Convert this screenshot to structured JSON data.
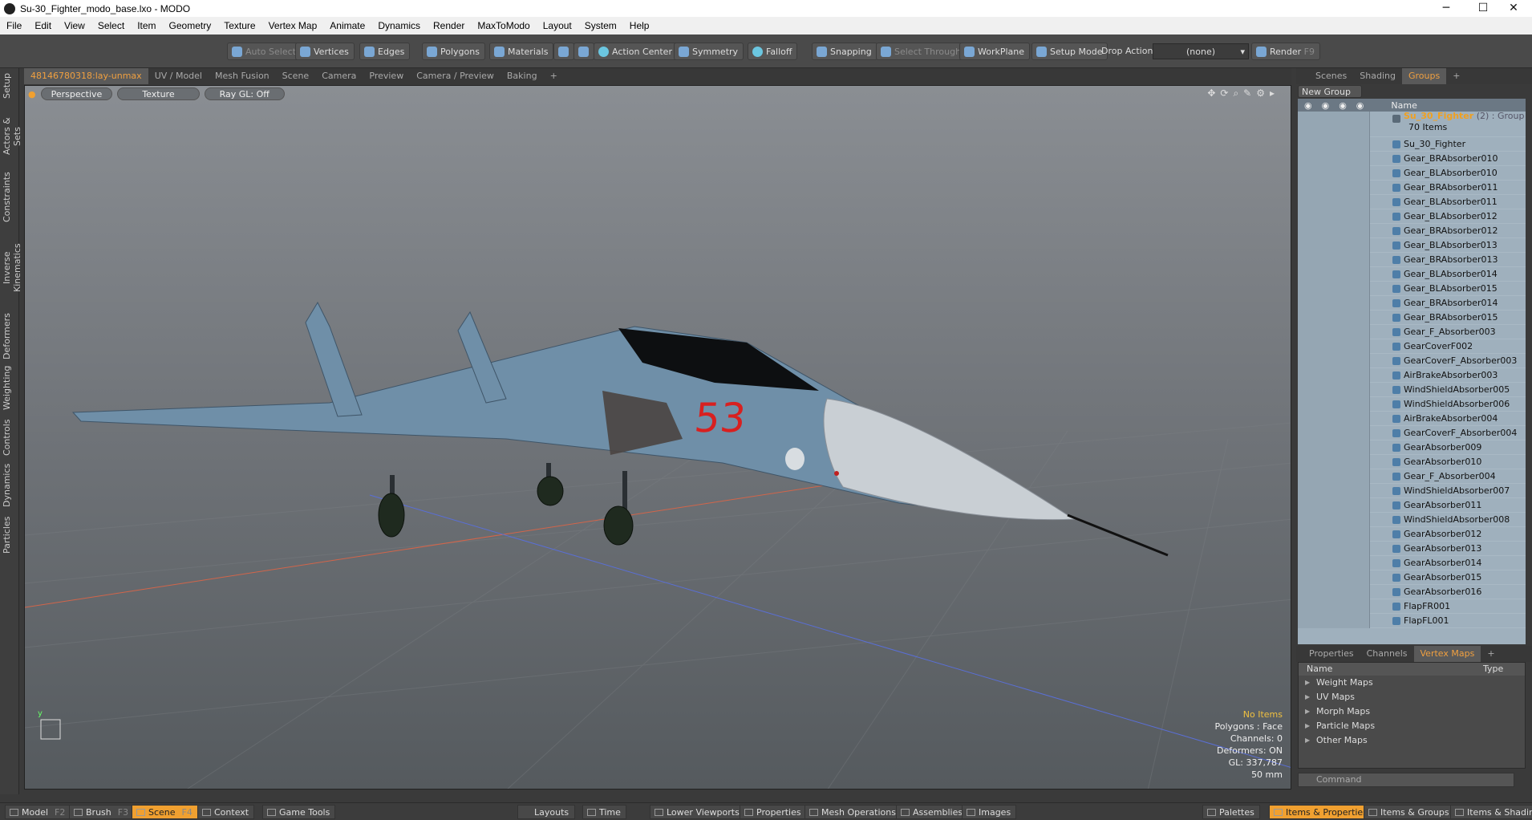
{
  "window": {
    "title": "Su-30_Fighter_modo_base.lxo - MODO",
    "min": "─",
    "max": "☐",
    "close": "✕"
  },
  "menu": [
    "File",
    "Edit",
    "View",
    "Select",
    "Item",
    "Geometry",
    "Texture",
    "Vertex Map",
    "Animate",
    "Dynamics",
    "Render",
    "MaxToModo",
    "Layout",
    "System",
    "Help"
  ],
  "toolbar": {
    "auto_select": "Auto Select",
    "vertices": "Vertices",
    "edges": "Edges",
    "polygons": "Polygons",
    "materials": "Materials",
    "action_center": "Action Center",
    "symmetry": "Symmetry",
    "falloff": "Falloff",
    "snapping": "Snapping",
    "select_through": "Select Through",
    "workplane": "WorkPlane",
    "setup_mode": "Setup Mode",
    "drop_action": "Drop Action",
    "drop_value": "(none)",
    "render": "Render",
    "render_key": "F9"
  },
  "left_tabs": [
    "Setup",
    "Actors & Sets",
    "Constraints",
    "Inverse Kinematics",
    "Deformers",
    "Weighting",
    "Controls",
    "Dynamics",
    "Particles"
  ],
  "viewport_tabs": [
    "48146780318:lay-unmax",
    "UV / Model",
    "Mesh Fusion",
    "Scene",
    "Camera",
    "Preview",
    "Camera / Preview",
    "Baking",
    "+"
  ],
  "viewport": {
    "view": "Perspective",
    "shading": "Texture",
    "raygl": "Ray GL: Off",
    "number": "53",
    "stats": {
      "items": "No Items",
      "polygons": "Polygons : Face",
      "channels": "Channels: 0",
      "deformers": "Deformers: ON",
      "gl": "GL: 337,787",
      "unit": "50 mm"
    }
  },
  "right_tabs": [
    "Scenes",
    "Shading",
    "Groups",
    "+"
  ],
  "groups": {
    "new_group": "New Group",
    "col_name": "Name",
    "group": "Su_30_Fighter",
    "group_meta": "(2) : Group",
    "count": "70 Items",
    "items": [
      "Su_30_Fighter",
      "Gear_BRAbsorber010",
      "Gear_BLAbsorber010",
      "Gear_BRAbsorber011",
      "Gear_BLAbsorber011",
      "Gear_BLAbsorber012",
      "Gear_BRAbsorber012",
      "Gear_BLAbsorber013",
      "Gear_BRAbsorber013",
      "Gear_BLAbsorber014",
      "Gear_BLAbsorber015",
      "Gear_BRAbsorber014",
      "Gear_BRAbsorber015",
      "Gear_F_Absorber003",
      "GearCoverF002",
      "GearCoverF_Absorber003",
      "AirBrakeAbsorber003",
      "WindShieldAbsorber005",
      "WindShieldAbsorber006",
      "AirBrakeAbsorber004",
      "GearCoverF_Absorber004",
      "GearAbsorber009",
      "GearAbsorber010",
      "Gear_F_Absorber004",
      "WindShieldAbsorber007",
      "GearAbsorber011",
      "WindShieldAbsorber008",
      "GearAbsorber012",
      "GearAbsorber013",
      "GearAbsorber014",
      "GearAbsorber015",
      "GearAbsorber016",
      "FlapFR001",
      "FlapFL001"
    ]
  },
  "props_tabs": [
    "Properties",
    "Channels",
    "Vertex Maps",
    "+"
  ],
  "vertex_maps": {
    "col_name": "Name",
    "col_type": "Type",
    "rows": [
      "Weight Maps",
      "UV Maps",
      "Morph Maps",
      "Particle Maps",
      "Other Maps"
    ]
  },
  "command": {
    "placeholder": "Command"
  },
  "bottom": {
    "model": "Model",
    "model_key": "F2",
    "brush": "Brush",
    "brush_key": "F3",
    "scene": "Scene",
    "scene_key": "F4",
    "context": "Context",
    "game_tools": "Game Tools",
    "layouts": "Layouts",
    "time": "Time",
    "lower_viewports": "Lower Viewports",
    "properties": "Properties",
    "mesh_operations": "Mesh Operations",
    "assemblies": "Assemblies",
    "images": "Images",
    "palettes": "Palettes",
    "items_properties": "Items & Properties",
    "items_groups": "Items & Groups",
    "items_shading": "Items & Shading"
  }
}
